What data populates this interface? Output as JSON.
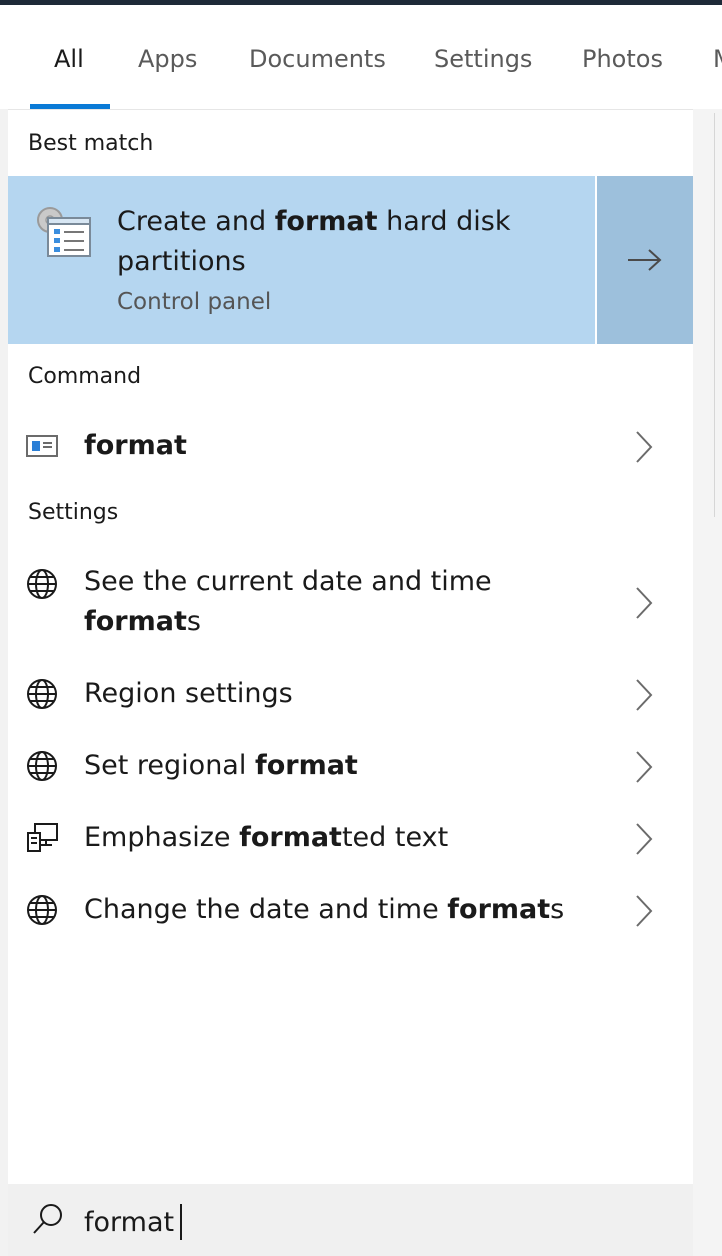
{
  "tabs": [
    {
      "label": "All",
      "active": true
    },
    {
      "label": "Apps"
    },
    {
      "label": "Documents"
    },
    {
      "label": "Settings"
    },
    {
      "label": "Photos"
    },
    {
      "label": "M"
    }
  ],
  "sections": {
    "best_match": "Best match",
    "command": "Command",
    "settings": "Settings"
  },
  "best_match": {
    "title_pre": "Create and ",
    "title_bold": "format",
    "title_post": " hard disk partitions",
    "subtitle": "Control panel",
    "icon": "disk-management-icon",
    "arrow_icon": "arrow-right-icon"
  },
  "command_item": {
    "bold": "format",
    "icon": "command-prompt-icon"
  },
  "settings_items": [
    {
      "pre": "See the current date and time ",
      "bold": "format",
      "post": "s",
      "icon": "globe-icon"
    },
    {
      "pre": "Region settings",
      "bold": "",
      "post": "",
      "icon": "globe-icon"
    },
    {
      "pre": "Set regional ",
      "bold": "format",
      "post": "",
      "icon": "globe-icon"
    },
    {
      "pre": "Emphasize ",
      "bold": "format",
      "post": "ted text",
      "icon": "accessibility-display-icon"
    },
    {
      "pre": "Change the date and time ",
      "bold": "format",
      "post": "s",
      "icon": "globe-icon"
    }
  ],
  "search": {
    "value": "format",
    "icon": "search-icon"
  },
  "colors": {
    "accent": "#0a7ad6",
    "best_match_bg": "#b5d6f0",
    "best_match_arrow_bg": "#9dc0dc"
  }
}
